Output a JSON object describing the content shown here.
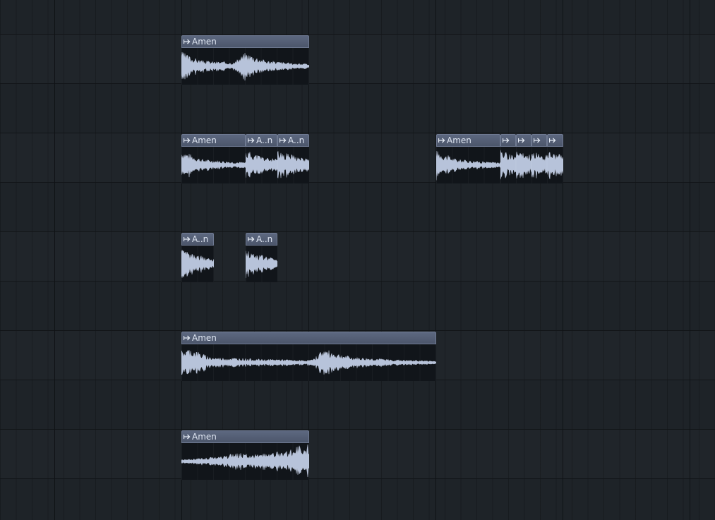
{
  "playlist": {
    "clips": [
      {
        "label": "Amen",
        "icon": "audio-clip-icon"
      },
      {
        "label": "Amen",
        "icon": "audio-clip-icon"
      },
      {
        "label": "A..n",
        "icon": "audio-clip-icon"
      },
      {
        "label": "A..n",
        "icon": "audio-clip-icon"
      },
      {
        "label": "Amen",
        "icon": "audio-clip-icon"
      },
      {
        "label": "",
        "icon": "audio-clip-icon"
      },
      {
        "label": "",
        "icon": "audio-clip-icon"
      },
      {
        "label": "",
        "icon": "audio-clip-icon"
      },
      {
        "label": "",
        "icon": "audio-clip-icon"
      },
      {
        "label": "A..n",
        "icon": "audio-clip-icon"
      },
      {
        "label": "A..n",
        "icon": "audio-clip-icon"
      },
      {
        "label": "Amen",
        "icon": "audio-clip-icon"
      },
      {
        "label": "Amen",
        "icon": "audio-clip-icon"
      }
    ]
  },
  "colors": {
    "background": "#1e2328",
    "clip_header": "#4c566b",
    "waveform": "#b7c3da"
  }
}
